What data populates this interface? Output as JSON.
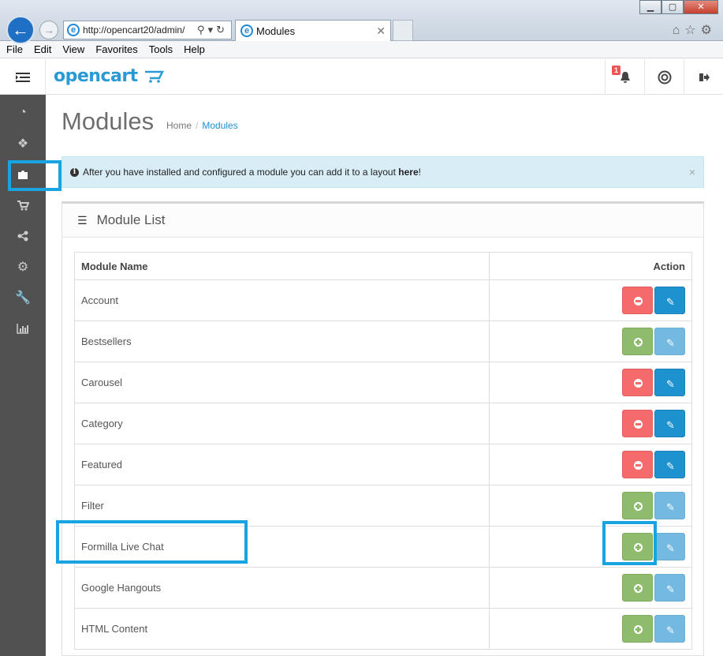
{
  "browser": {
    "address": "http://opencart20/admin/",
    "tab_title": "Modules",
    "menu": [
      "File",
      "Edit",
      "View",
      "Favorites",
      "Tools",
      "Help"
    ]
  },
  "header": {
    "logo": "opencart",
    "notification_count": "1"
  },
  "page": {
    "title": "Modules",
    "breadcrumb": [
      "Home",
      "Modules"
    ]
  },
  "alert": {
    "text_before": "After you have installed and configured a module you can add it to a layout",
    "link": "here",
    "text_after": "!"
  },
  "panel": {
    "title": "Module List",
    "columns": {
      "name": "Module Name",
      "action": "Action"
    },
    "rows": [
      {
        "name": "Account",
        "installed": true
      },
      {
        "name": "Bestsellers",
        "installed": false
      },
      {
        "name": "Carousel",
        "installed": true
      },
      {
        "name": "Category",
        "installed": true
      },
      {
        "name": "Featured",
        "installed": true
      },
      {
        "name": "Filter",
        "installed": false
      },
      {
        "name": "Formilla Live Chat",
        "installed": false
      },
      {
        "name": "Google Hangouts",
        "installed": false
      },
      {
        "name": "HTML Content",
        "installed": false
      }
    ]
  },
  "colors": {
    "accent": "#1e91cf",
    "highlight": "#1aa3e1",
    "uninstall": "#f56b6b",
    "install": "#8fbb6c",
    "sidebar": "#515151"
  },
  "icons": {
    "sidebar": [
      "dashboard-icon",
      "tag-icon",
      "puzzle-icon",
      "cart-icon",
      "share-icon",
      "gear-icon",
      "wrench-icon",
      "bar-chart-icon"
    ]
  }
}
